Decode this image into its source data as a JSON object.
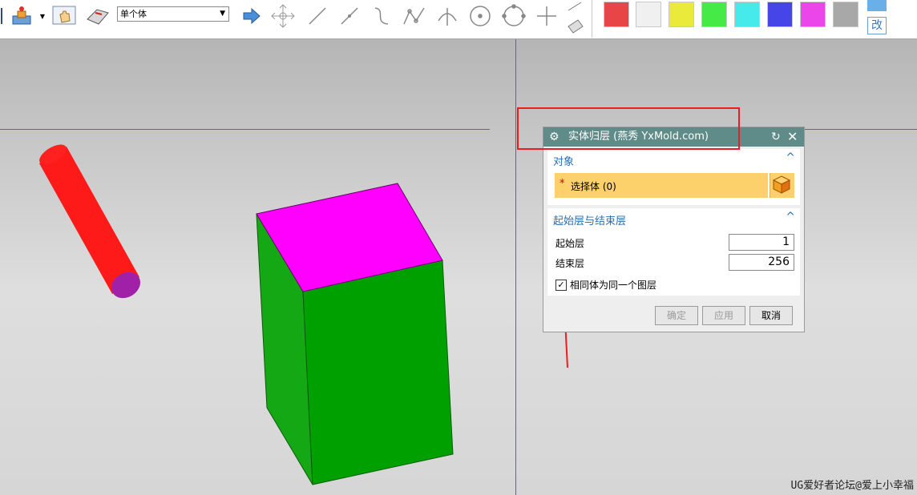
{
  "toolbar": {
    "selection_filter": "单个体",
    "color_swatches": [
      "#e84646",
      "#f0f0f0",
      "#eaea3a",
      "#46ea46",
      "#46eaea",
      "#4646e8",
      "#ea46ea",
      "#a8a8a8"
    ],
    "edit_button_label": "改",
    "icons": [
      "layer-settings-icon",
      "dropdown-arrow-icon",
      "hand-tool-icon",
      "eraser-icon",
      "arrow-right-icon",
      "move-points-icon",
      "line-icon",
      "line-point-icon",
      "curve-icon",
      "polyline-icon",
      "arc-icon",
      "circle-point-icon",
      "circle-icon",
      "cross-point-icon",
      "pen-tool-icon"
    ]
  },
  "viewport": {
    "watermark": "UG爱好者论坛@爱上小幸福",
    "shapes": [
      "red-cylinder",
      "green-box"
    ]
  },
  "dialog": {
    "title": "实体归层  (燕秀 YxMold.com)",
    "section_object": {
      "header": "对象",
      "select_label": "选择体 (0)",
      "required_marker": "*"
    },
    "section_layers": {
      "header": "起始层与结束层",
      "start_label": "起始层",
      "start_value": "1",
      "end_label": "结束层",
      "end_value": "256",
      "checkbox_label": "相同体为同一个图层",
      "checkbox_checked": true
    },
    "buttons": {
      "ok": "确定",
      "apply": "应用",
      "cancel": "取消"
    }
  }
}
